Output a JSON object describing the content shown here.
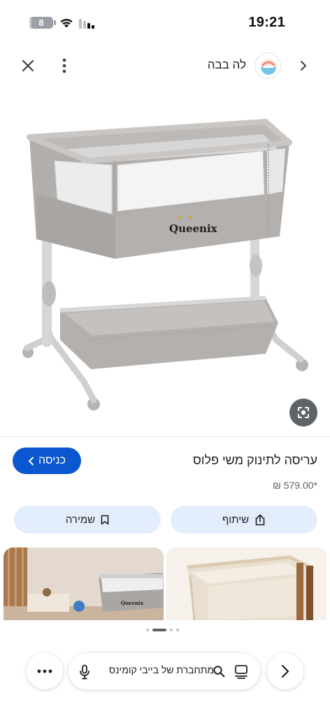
{
  "status_bar": {
    "time": "19:21",
    "battery_level": "8",
    "battery_fraction": 0.08
  },
  "top_bar": {
    "site_name": "לה בבה",
    "icons": [
      "close-icon",
      "more-vert-icon",
      "chevron-left-icon"
    ]
  },
  "product": {
    "title": "עריסה לתינוק משי פלוס",
    "price": "*579.00 ₪",
    "brand_mark": "Queenix"
  },
  "buttons": {
    "visit_label": "כניסה",
    "share_label": "שיתוף",
    "save_label": "שמירה"
  },
  "related": {
    "left_brand": "Queenix"
  },
  "pagination": {
    "count": 4,
    "active_index": 1
  },
  "bottom_bar": {
    "search_query": "מתחברת של בייבי קומינס",
    "icons": [
      "more-horiz-icon",
      "mic-icon",
      "search-icon",
      "tabs-icon",
      "chevron-right-icon"
    ]
  },
  "colors": {
    "accent": "#0b57d0",
    "chip_background": "#e4edfb",
    "lens_button": "#5f6368"
  }
}
